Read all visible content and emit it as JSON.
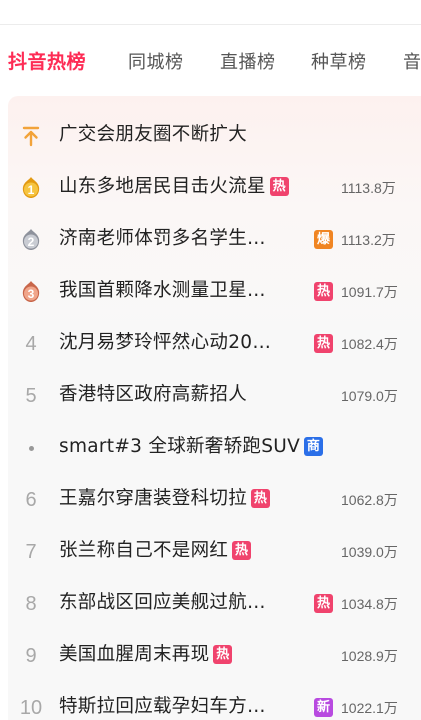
{
  "tabs": [
    {
      "label": "抖音热榜",
      "active": true
    },
    {
      "label": "同城榜"
    },
    {
      "label": "直播榜"
    },
    {
      "label": "种草榜"
    },
    {
      "label": "音"
    }
  ],
  "colors": {
    "accent": "#fe2c55",
    "hot": "#f0436d",
    "boom": "#f08522",
    "new": "#b84ae0",
    "brand": "#2b6fe8"
  },
  "list": [
    {
      "rank": "pinned",
      "title": "广交会朋友圈不断扩大",
      "badge": "",
      "heat": ""
    },
    {
      "rank": "1",
      "medal": "gold",
      "title": "山东多地居民目击火流星",
      "badge": "热",
      "badge_type": "hot",
      "heat": "1113.8万"
    },
    {
      "rank": "2",
      "medal": "silver",
      "title": "济南老师体罚多名学生…",
      "badge": "爆",
      "badge_type": "boom",
      "heat": "1113.2万"
    },
    {
      "rank": "3",
      "medal": "bronze",
      "title": "我国首颗降水测量卫星…",
      "badge": "热",
      "badge_type": "hot",
      "heat": "1091.7万"
    },
    {
      "rank": "4",
      "title": "沈月易梦玲怦然心动20…",
      "badge": "热",
      "badge_type": "hot",
      "heat": "1082.4万"
    },
    {
      "rank": "5",
      "title": "香港特区政府高薪招人",
      "badge": "",
      "heat": "1079.0万"
    },
    {
      "rank": "dot",
      "title": "smart#3 全球新奢轿跑SUV",
      "badge": "商",
      "badge_type": "brand",
      "heat": ""
    },
    {
      "rank": "6",
      "title": "王嘉尔穿唐装登科切拉",
      "badge": "热",
      "badge_type": "hot",
      "heat": "1062.8万"
    },
    {
      "rank": "7",
      "title": "张兰称自己不是网红",
      "badge": "热",
      "badge_type": "hot",
      "heat": "1039.0万"
    },
    {
      "rank": "8",
      "title": "东部战区回应美舰过航…",
      "badge": "热",
      "badge_type": "hot",
      "heat": "1034.8万"
    },
    {
      "rank": "9",
      "title": "美国血腥周末再现",
      "badge": "热",
      "badge_type": "hot",
      "heat": "1028.9万"
    },
    {
      "rank": "10",
      "title": "特斯拉回应载孕妇车方…",
      "badge": "新",
      "badge_type": "new",
      "heat": "1022.1万"
    }
  ]
}
